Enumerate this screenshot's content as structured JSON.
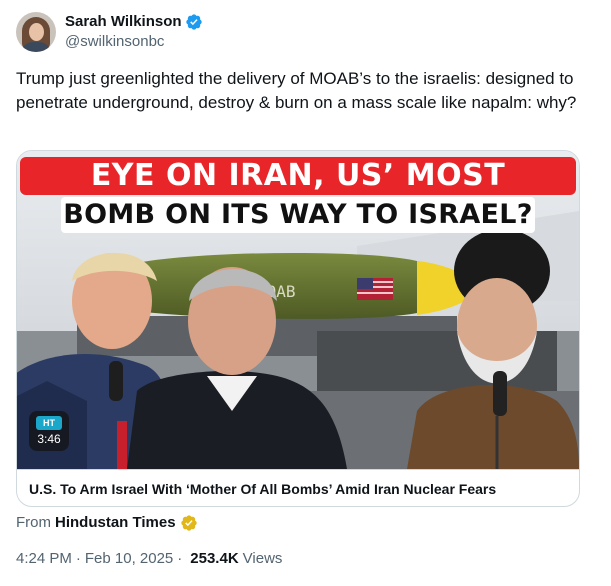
{
  "author": {
    "display_name": "Sarah Wilkinson",
    "handle": "@swilkinsonbc",
    "verified": true
  },
  "tweet": {
    "text": "Trump just greenlighted the delivery of MOAB’s to the israelis: designed to penetrate underground, destroy & burn on a mass scale like napalm: why?"
  },
  "card": {
    "headline_line1": "EYE ON IRAN, US’ MOST POWERFUL",
    "headline_line2": "BOMB ON ITS WAY TO ISRAEL?",
    "bomb_label": "MOAB",
    "video_logo": "HT",
    "video_duration": "3:46",
    "title": "U.S. To Arm Israel With ‘Mother Of All Bombs’ Amid Iran Nuclear Fears"
  },
  "source": {
    "from_label": "From",
    "name": "Hindustan Times"
  },
  "meta": {
    "time": "4:24 PM",
    "date": "Feb 10, 2025",
    "separator": "·",
    "views_count": "253.4K",
    "views_label": "Views"
  },
  "colors": {
    "verified_blue": "#1d9bf0",
    "gold_badge": "#e2b719",
    "headline_red": "#e8262a"
  }
}
